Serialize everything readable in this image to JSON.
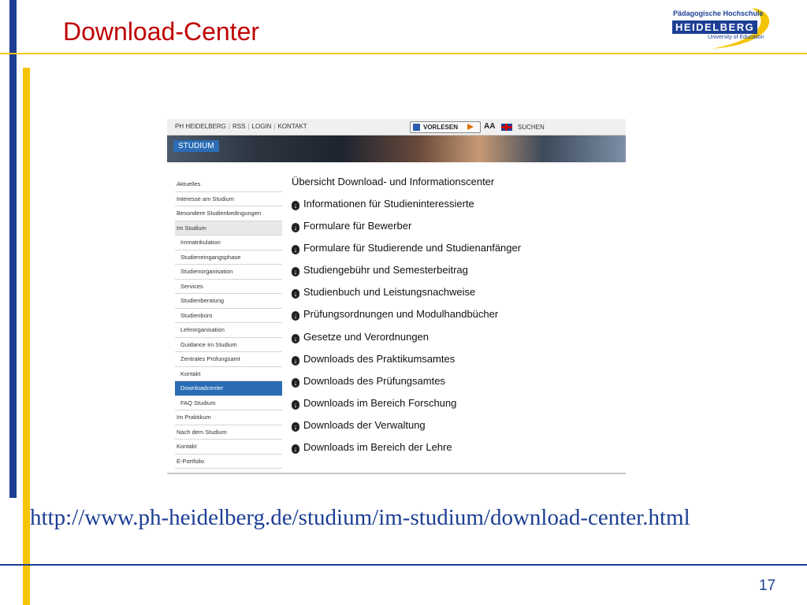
{
  "slide": {
    "title": "Download-Center",
    "url": "http://www.ph-heidelberg.de/studium/im-studium/download-center.html",
    "page_number": "17"
  },
  "logo": {
    "top_text": "Pädagogische Hochschule",
    "main_text": "HEIDELBERG",
    "sub_text": "University of Education"
  },
  "site": {
    "topnav": [
      "PH HEIDELBERG",
      "RSS",
      "LOGIN",
      "KONTAKT"
    ],
    "read_aloud_label": "VORLESEN",
    "font_size_label": "AA",
    "search_label": "SUCHEN",
    "banner_tag": "STUDIUM",
    "sidebar": {
      "items": [
        "Aktuelles",
        "Interesse am Studium",
        "Besondere Studienbedingungen",
        "Im Studium",
        "Immatrikulation",
        "Studieneingangsphase",
        "Studienorganisation",
        "Services",
        "Studienberatung",
        "Studienbüro",
        "Lehrorganisation",
        "Guidance im Studium",
        "Zentrales Prüfungsamt",
        "Kontakt",
        "Downloadcenter",
        "FAQ Studium",
        "Im Praktikum",
        "Nach dem Studium",
        "Kontakt",
        "E-Portfolio"
      ]
    },
    "content": {
      "title": "Übersicht Download- und Informationscenter",
      "links": [
        "Informationen für Studieninteressierte",
        "Formulare für Bewerber",
        "Formulare für Studierende und Studienanfänger",
        "Studiengebühr und Semesterbeitrag",
        "Studienbuch und Leistungsnachweise",
        "Prüfungsordnungen und Modulhandbücher",
        "Gesetze und Verordnungen",
        "Downloads des Praktikumsamtes",
        "Downloads des Prüfungsamtes",
        "Downloads im Bereich Forschung",
        "Downloads der Verwaltung",
        "Downloads im Bereich der Lehre"
      ]
    }
  },
  "colors": {
    "title_red": "#c00000",
    "brand_blue": "#1c3f94",
    "accent_gold": "#f5c400",
    "nav_active_blue": "#2a6db5"
  }
}
